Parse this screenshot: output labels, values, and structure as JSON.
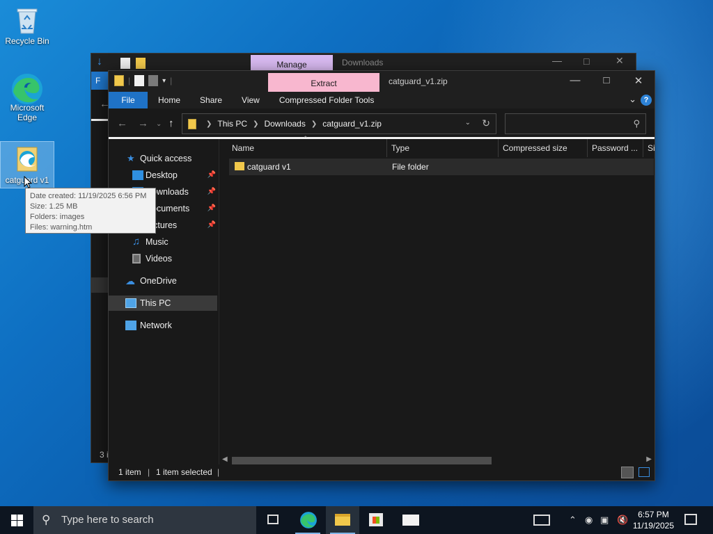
{
  "desktop": {
    "icons": [
      {
        "label": "Recycle Bin"
      },
      {
        "label": "Microsoft Edge"
      },
      {
        "label": "catguard v1"
      }
    ]
  },
  "tooltip": {
    "date_created": "Date created: 11/19/2025 6:56 PM",
    "size": "Size: 1.25 MB",
    "folders": "Folders: images",
    "files": "Files: warning.htm"
  },
  "back_window": {
    "manage_tab": "Manage",
    "title": "Downloads",
    "status_fragment": "3 i"
  },
  "window": {
    "contextual_tab": "Extract",
    "title": "catguard_v1.zip",
    "ribbon_tabs": [
      "File",
      "Home",
      "Share",
      "View",
      "Compressed Folder Tools"
    ],
    "help_label": "?",
    "address": {
      "segments": [
        "This PC",
        "Downloads",
        "catguard_v1.zip"
      ]
    },
    "search_placeholder": "",
    "nav_pane": {
      "quick_access": "Quick access",
      "items": [
        {
          "label": "Desktop",
          "pinned": true
        },
        {
          "label": "Downloads",
          "pinned": true
        },
        {
          "label": "Documents",
          "pinned": true
        },
        {
          "label": "Pictures",
          "pinned": true
        },
        {
          "label": "Music"
        },
        {
          "label": "Videos"
        }
      ],
      "onedrive": "OneDrive",
      "this_pc": "This PC",
      "network": "Network"
    },
    "columns": [
      "Name",
      "Type",
      "Compressed size",
      "Password ...",
      "Si"
    ],
    "rows": [
      {
        "name": "catguard v1",
        "type": "File folder"
      }
    ],
    "status": {
      "count": "1 item",
      "selected": "1 item selected"
    }
  },
  "taskbar": {
    "search_placeholder": "Type here to search",
    "time": "6:57 PM",
    "date": "11/19/2025"
  },
  "colors": {
    "extract_tab": "#f8b7cf",
    "manage_tab": "#d8b9f0",
    "file_tab": "#1f72c6",
    "window_bg": "#191919"
  }
}
